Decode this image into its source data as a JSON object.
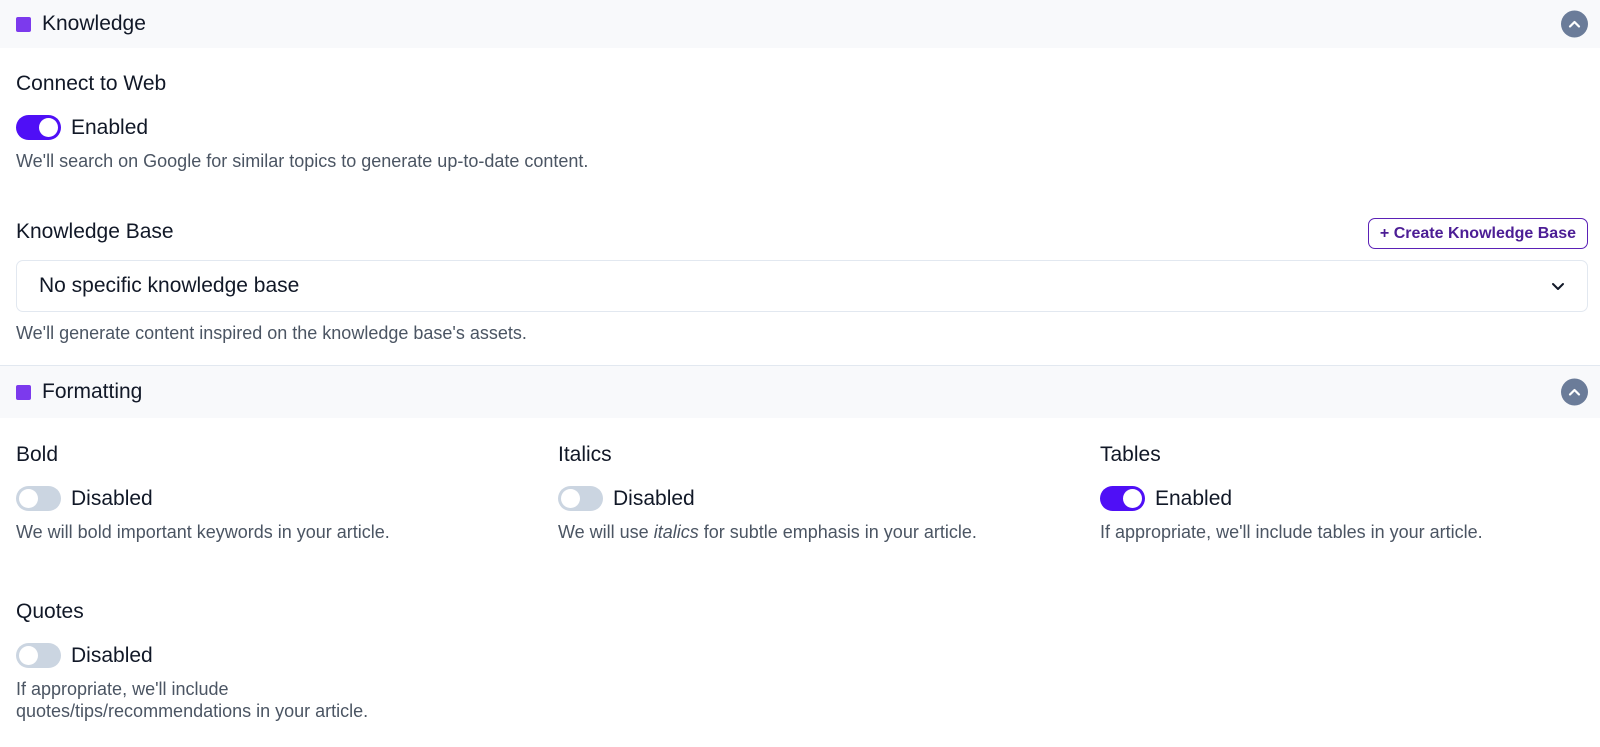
{
  "knowledge": {
    "title": "Knowledge",
    "collapse_icon": "chevron-up-icon",
    "connect_to_web": {
      "label": "Connect to Web",
      "enabled": true,
      "state_text": "Enabled",
      "description": "We'll search on Google for similar topics to generate up-to-date content."
    },
    "knowledge_base": {
      "label": "Knowledge Base",
      "create_button": "+ Create Knowledge Base",
      "selected": "No specific knowledge base",
      "description": "We'll generate content inspired on the knowledge base's assets."
    }
  },
  "formatting": {
    "title": "Formatting",
    "collapse_icon": "chevron-up-icon",
    "options": {
      "bold": {
        "label": "Bold",
        "enabled": false,
        "state_text": "Disabled",
        "description": "We will bold important keywords in your article."
      },
      "italics": {
        "label": "Italics",
        "enabled": false,
        "state_text": "Disabled",
        "description_pre": "We will use ",
        "description_em": "italics",
        "description_post": " for subtle emphasis in your article."
      },
      "tables": {
        "label": "Tables",
        "enabled": true,
        "state_text": "Enabled",
        "description": "If appropriate, we'll include tables in your article."
      },
      "quotes": {
        "label": "Quotes",
        "enabled": false,
        "state_text": "Disabled",
        "description_line1": "If appropriate, we'll include",
        "description_line2": "quotes/tips/recommendations in your article."
      }
    }
  },
  "colors": {
    "accent": "#4f0ff6",
    "section_marker": "#7c3aed",
    "toggle_off": "#cbd5e1",
    "collapse_button": "#6b7c99"
  }
}
